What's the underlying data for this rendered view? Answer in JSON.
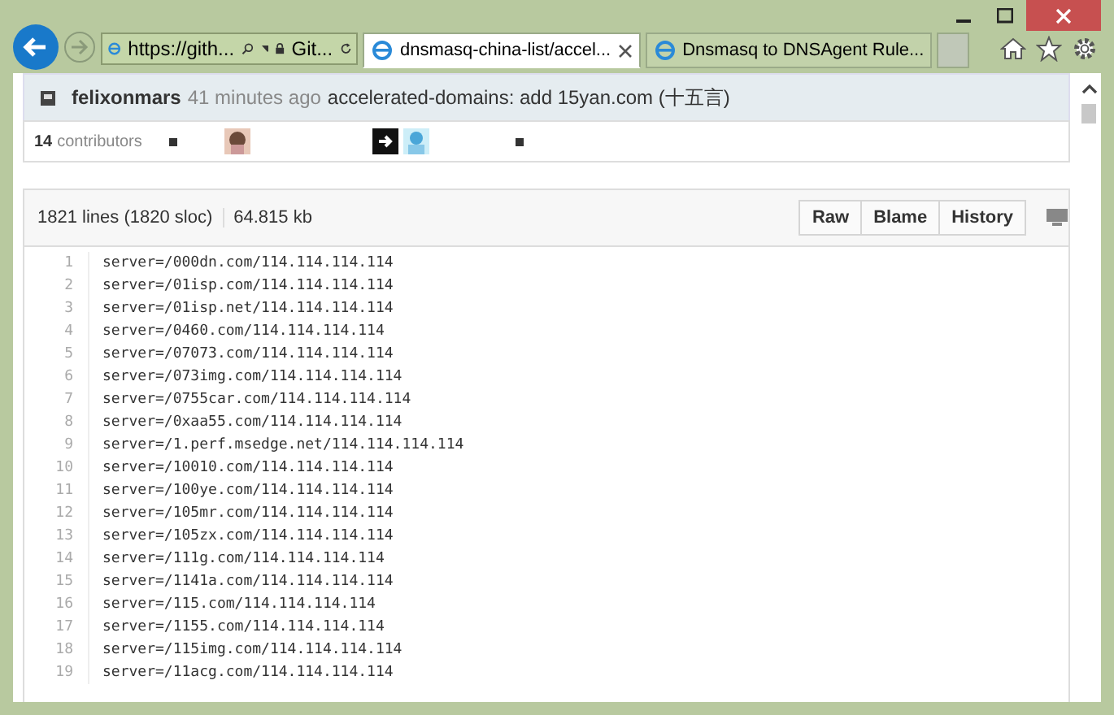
{
  "browser": {
    "address": "https://gith...",
    "site_label": "Git...",
    "tabs": [
      {
        "label": "dnsmasq-china-list/accel...",
        "selected": true
      },
      {
        "label": "Dnsmasq to DNSAgent Rule...",
        "selected": false
      }
    ]
  },
  "commit": {
    "author": "felixonmars",
    "time": "41 minutes ago",
    "message": "accelerated-domains: add 15yan.com (十五言)"
  },
  "contributors": {
    "count": "14",
    "label": "contributors"
  },
  "file": {
    "lines": "1821 lines (1820 sloc)",
    "size": "64.815 kb",
    "buttons": [
      "Raw",
      "Blame",
      "History"
    ]
  },
  "code": [
    {
      "number": "1",
      "text": "server=/000dn.com/114.114.114.114"
    },
    {
      "number": "2",
      "text": "server=/01isp.com/114.114.114.114"
    },
    {
      "number": "3",
      "text": "server=/01isp.net/114.114.114.114"
    },
    {
      "number": "4",
      "text": "server=/0460.com/114.114.114.114"
    },
    {
      "number": "5",
      "text": "server=/07073.com/114.114.114.114"
    },
    {
      "number": "6",
      "text": "server=/073img.com/114.114.114.114"
    },
    {
      "number": "7",
      "text": "server=/0755car.com/114.114.114.114"
    },
    {
      "number": "8",
      "text": "server=/0xaa55.com/114.114.114.114"
    },
    {
      "number": "9",
      "text": "server=/1.perf.msedge.net/114.114.114.114"
    },
    {
      "number": "10",
      "text": "server=/10010.com/114.114.114.114"
    },
    {
      "number": "11",
      "text": "server=/100ye.com/114.114.114.114"
    },
    {
      "number": "12",
      "text": "server=/105mr.com/114.114.114.114"
    },
    {
      "number": "13",
      "text": "server=/105zx.com/114.114.114.114"
    },
    {
      "number": "14",
      "text": "server=/111g.com/114.114.114.114"
    },
    {
      "number": "15",
      "text": "server=/1141a.com/114.114.114.114"
    },
    {
      "number": "16",
      "text": "server=/115.com/114.114.114.114"
    },
    {
      "number": "17",
      "text": "server=/1155.com/114.114.114.114"
    },
    {
      "number": "18",
      "text": "server=/115img.com/114.114.114.114"
    },
    {
      "number": "19",
      "text": "server=/11acg.com/114.114.114.114"
    }
  ]
}
